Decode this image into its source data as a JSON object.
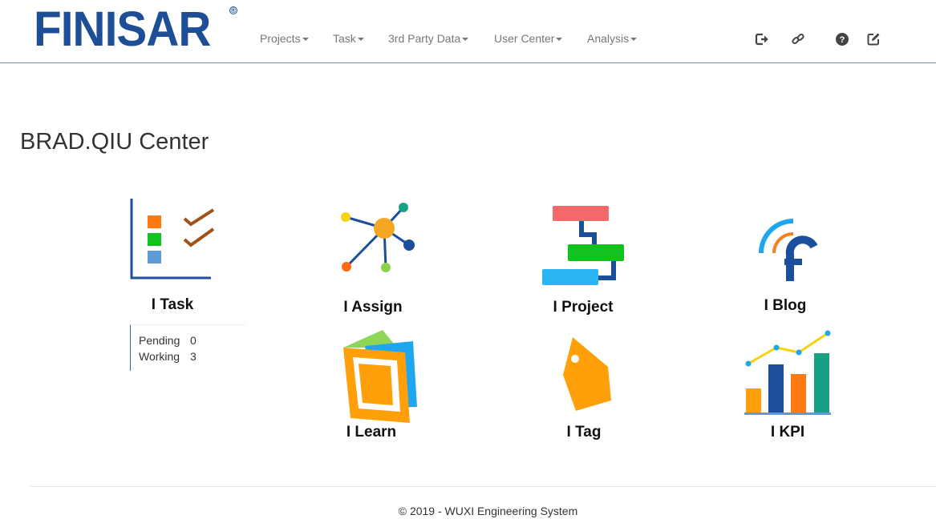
{
  "header": {
    "logo_text": "FINISAR",
    "logo_mark": "®",
    "menu": [
      {
        "label": "Projects"
      },
      {
        "label": "Task"
      },
      {
        "label": "3rd Party Data"
      },
      {
        "label": "User Center"
      },
      {
        "label": "Analysis"
      }
    ],
    "icons": [
      "logout-icon",
      "link-icon",
      "help-icon",
      "edit-icon"
    ]
  },
  "page": {
    "title": "BRAD.QIU Center"
  },
  "tiles": [
    {
      "label": "I Task",
      "icon": "task-checklist-icon"
    },
    {
      "label": "I Assign",
      "icon": "assign-network-icon"
    },
    {
      "label": "I Project",
      "icon": "project-gantt-icon"
    },
    {
      "label": "I Blog",
      "icon": "blog-feed-icon"
    },
    {
      "label": "I Learn",
      "icon": "learn-book-icon"
    },
    {
      "label": "I Tag",
      "icon": "tag-icon"
    },
    {
      "label": "I KPI",
      "icon": "kpi-chart-icon"
    }
  ],
  "task_stats": [
    {
      "label": "Pending",
      "value": "0"
    },
    {
      "label": "Working",
      "value": "3"
    }
  ],
  "footer": {
    "text": "© 2019 - WUXI Engineering System"
  }
}
